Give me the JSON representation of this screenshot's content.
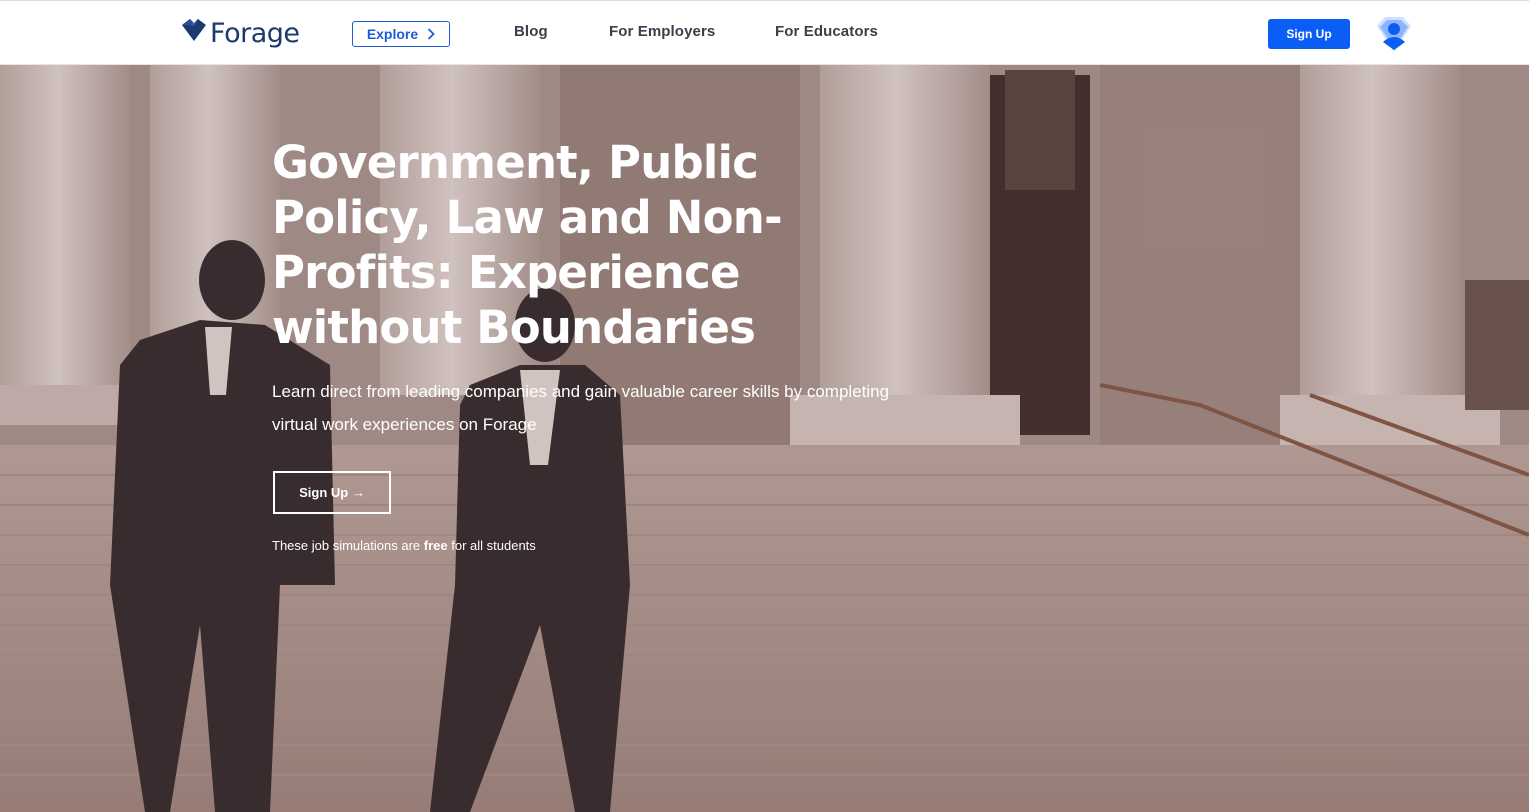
{
  "header": {
    "logo_text": "Forage",
    "explore_label": "Explore",
    "nav": {
      "blog": "Blog",
      "employers": "For Employers",
      "educators": "For Educators"
    },
    "signup_label": "Sign Up"
  },
  "hero": {
    "title": "Government, Public Policy, Law and Non-Profits: Experience without Boundaries",
    "subtitle": "Learn direct from leading companies and gain valuable career skills by completing virtual work experiences on Forage",
    "cta_label": "Sign Up →",
    "note_prefix": "These job simulations are",
    "note_bold": "free",
    "note_suffix": "for all students"
  },
  "icons": {
    "logo": "forage-logo-icon",
    "explore_chevron": "chevron-right-icon",
    "avatar": "user-avatar-icon"
  },
  "colors": {
    "brand_blue": "#0b5ef5",
    "explore_blue": "#1e5bd6",
    "logo_navy": "#1b3a6e",
    "nav_text": "#3a3f4a",
    "hero_text": "#ffffff"
  }
}
